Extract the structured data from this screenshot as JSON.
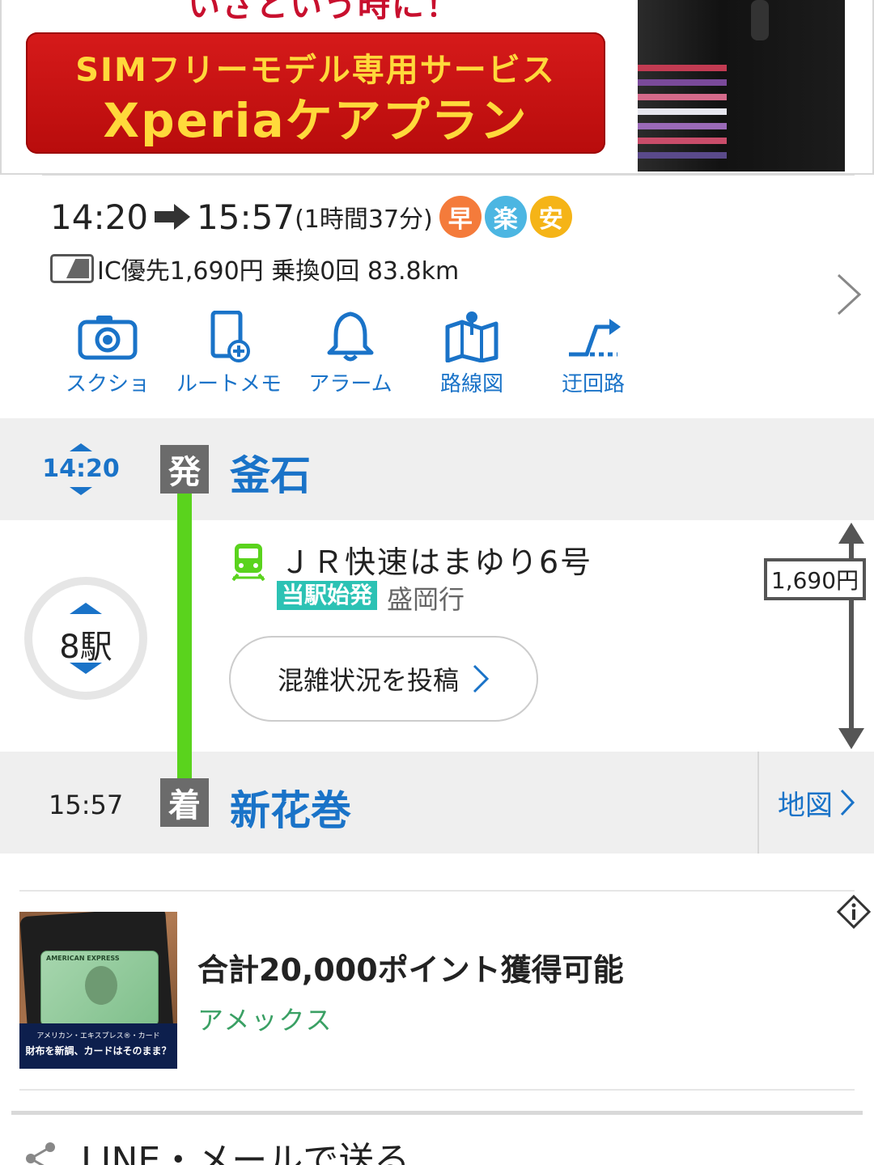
{
  "ad_banner": {
    "tagline": "いざという時に！",
    "line1": "SIMフリーモデル専用サービス",
    "line2": "Xperiaケアプラン"
  },
  "summary": {
    "depart_time": "14:20",
    "arrive_time": "15:57",
    "duration": "(1時間37分)",
    "badges": [
      "早",
      "楽",
      "安"
    ],
    "fare_text": "IC優先1,690円 乗換0回 83.8km"
  },
  "toolbar": [
    {
      "label": "スクショ",
      "icon": "camera-icon"
    },
    {
      "label": "ルートメモ",
      "icon": "memo-add-icon"
    },
    {
      "label": "アラーム",
      "icon": "bell-icon"
    },
    {
      "label": "路線図",
      "icon": "route-map-icon"
    },
    {
      "label": "迂回路",
      "icon": "detour-icon"
    }
  ],
  "route": {
    "departure": {
      "time": "14:20",
      "mark": "発",
      "station": "釜石"
    },
    "stops_label": "8駅",
    "train": {
      "name": "ＪＲ快速はまゆり6号",
      "start_badge": "当駅始発",
      "destination": "盛岡行"
    },
    "congestion_button": "混雑状況を投稿",
    "fare": "1,690円",
    "arrival": {
      "time": "15:57",
      "mark": "着",
      "station": "新花巻"
    },
    "map_button": "地図"
  },
  "ad2": {
    "title": "合計20,000ポイント獲得可能",
    "sponsor": "アメックス",
    "image_text_top": "アメリカン・エキスプレス®・カード",
    "image_text_main": "財布を新調、カードはそのまま？",
    "card_brand": "AMERICAN EXPRESS"
  },
  "share": {
    "label": "LINE・メールで送る"
  },
  "colors": {
    "accent_blue": "#1a73c8",
    "line_green": "#5ad31d",
    "badge_fast": "#f47b3b",
    "badge_easy": "#4cb6e2",
    "badge_cheap": "#f5b417",
    "start_badge": "#2cc2b4",
    "sponsor_green": "#3aa064"
  }
}
